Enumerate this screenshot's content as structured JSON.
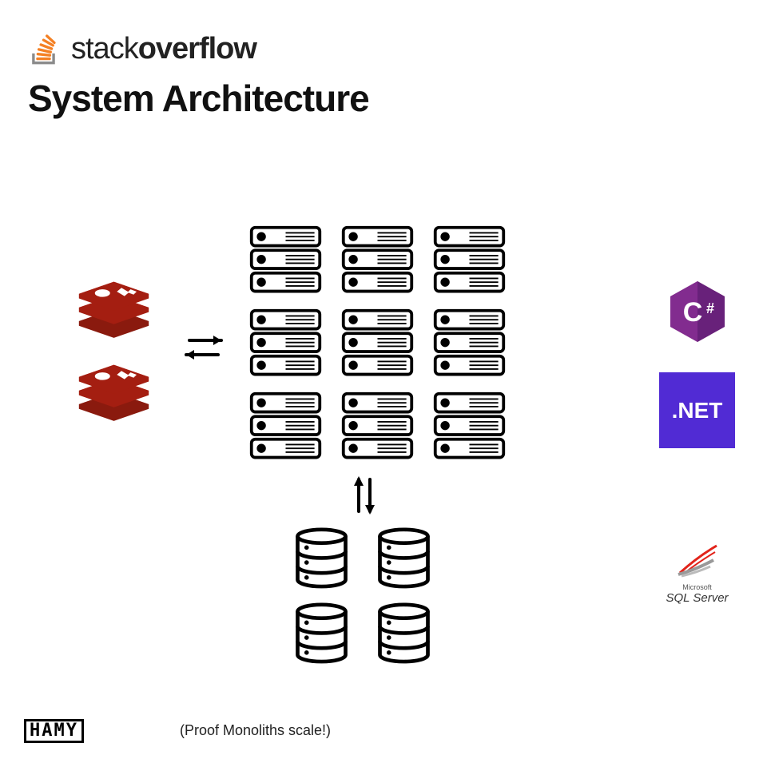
{
  "header": {
    "brand_part1": "stack",
    "brand_part2": "overflow",
    "title": "System Architecture"
  },
  "diagram": {
    "cache": {
      "name": "redis",
      "count": 2
    },
    "servers": {
      "rows": 3,
      "cols": 3
    },
    "databases": {
      "rows": 2,
      "cols": 2
    }
  },
  "tech": {
    "csharp": "C#",
    "dotnet": ".NET",
    "sqlserver_brand": "Microsoft",
    "sqlserver_name": "SQL Server"
  },
  "footer": {
    "watermark": "HAMY",
    "caption": "(Proof Monoliths scale!)"
  }
}
